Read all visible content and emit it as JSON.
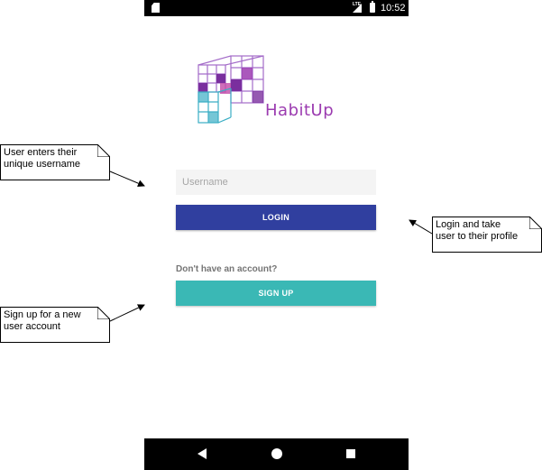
{
  "status_bar": {
    "time": "10:52",
    "network": "LTE",
    "icons": [
      "sd-card-icon",
      "signal-icon",
      "battery-charging-icon"
    ]
  },
  "app": {
    "brand_name": "HabitUp",
    "username": {
      "value": "",
      "placeholder": "Username"
    },
    "login_label": "LOGIN",
    "no_account_text": "Don't have an account?",
    "signup_label": "SIGN UP"
  },
  "nav_bar": {
    "icons": [
      "back-icon",
      "home-icon",
      "recents-icon"
    ]
  },
  "annotations": {
    "username_note": [
      "User enters their",
      "unique username"
    ],
    "login_note": [
      "Login and take",
      "user to their profile"
    ],
    "signup_note": [
      "Sign up for a new",
      "user account"
    ]
  },
  "colors": {
    "login_button": "#303f9f",
    "signup_button": "#3ab8b5",
    "brand_purple": "#9b3bb0",
    "logo_teal": "#3aaec4"
  }
}
